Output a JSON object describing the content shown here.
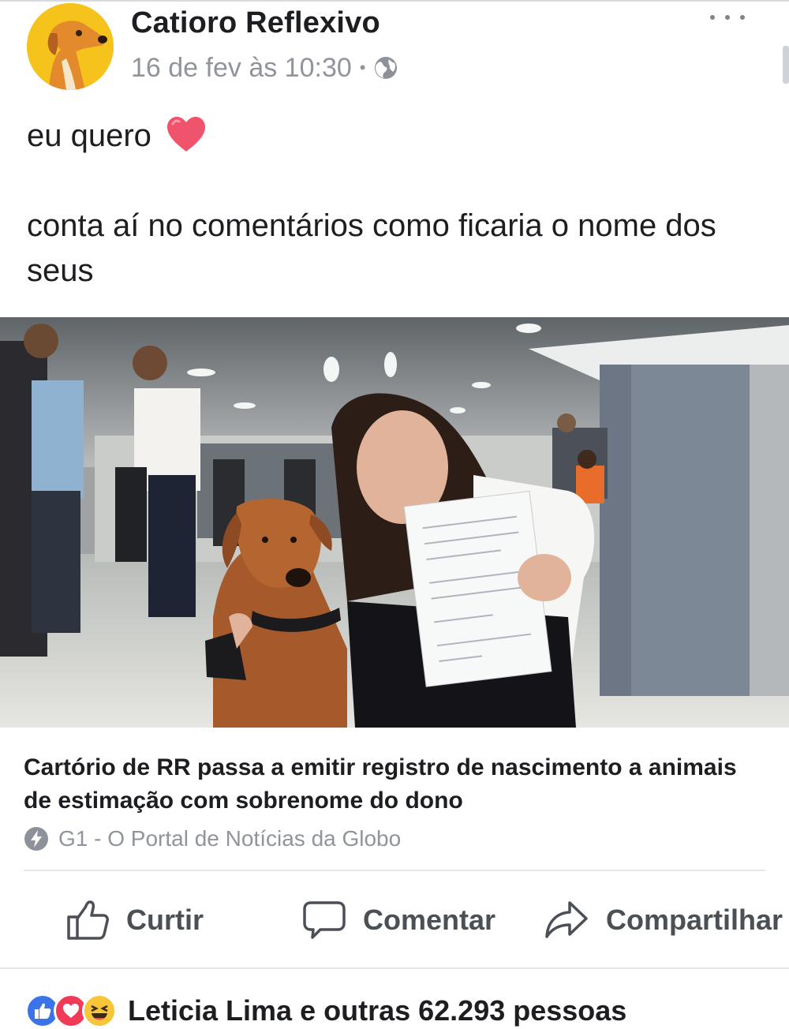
{
  "post": {
    "author": "Catioro Reflexivo",
    "timestamp": "16 de fev às 10:30",
    "separator": "•",
    "privacy_icon": "globe-icon",
    "more_icon": "ellipsis-icon",
    "text_line1": "eu quero",
    "text_line1_emoji": "heart-icon",
    "text_line2": "conta aí no comentários como ficaria o nome dos seus"
  },
  "link_card": {
    "title": "Cartório de RR passa a emitir registro de nascimento a animais de estimação com sobrenome do dono",
    "source": "G1 - O Portal de Notícias da Globo",
    "source_icon": "lightning-bolt-icon"
  },
  "actions": {
    "like": "Curtir",
    "comment": "Comentar",
    "share": "Compartilhar"
  },
  "reactions": {
    "icons": [
      "like-icon",
      "love-icon",
      "haha-icon"
    ],
    "summary": "Leticia Lima e outras 62.293 pessoas"
  },
  "colors": {
    "text": "#1c1e21",
    "meta": "#90949c",
    "action": "#4b4f56",
    "like_blue": "#3b73e8",
    "love_red": "#f03a58",
    "haha_yellow": "#f7c43a",
    "avatar_bg": "#f6c21c"
  }
}
